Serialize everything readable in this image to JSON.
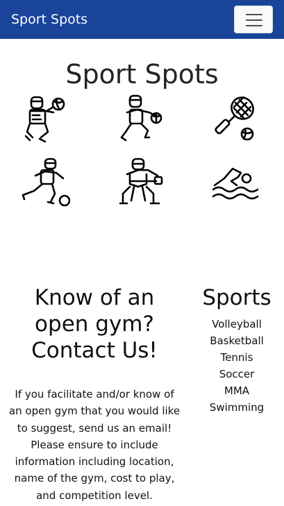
{
  "navbar": {
    "brand": "Sport Spots",
    "toggle_icon": "hamburger-menu-icon"
  },
  "page": {
    "title": "Sport Spots"
  },
  "icons": [
    {
      "name": "volleyball-player-icon"
    },
    {
      "name": "basketball-player-icon"
    },
    {
      "name": "tennis-racket-icon"
    },
    {
      "name": "soccer-player-icon"
    },
    {
      "name": "martial-artist-icon"
    },
    {
      "name": "swimmer-icon"
    }
  ],
  "contact": {
    "heading": "Know of an open gym? Contact Us!",
    "body": "If you facilitate and/or know of an open gym that you would like to suggest, send us an email! Please ensure to include information including location, name of the gym, cost to play, and competition level."
  },
  "sports": {
    "heading": "Sports",
    "items": [
      "Volleyball",
      "Basketball",
      "Tennis",
      "Soccer",
      "MMA",
      "Swimming"
    ]
  },
  "colors": {
    "navbar_bg": "#19449a",
    "toggler_bg": "#f8f9fa",
    "text": "#212529"
  }
}
